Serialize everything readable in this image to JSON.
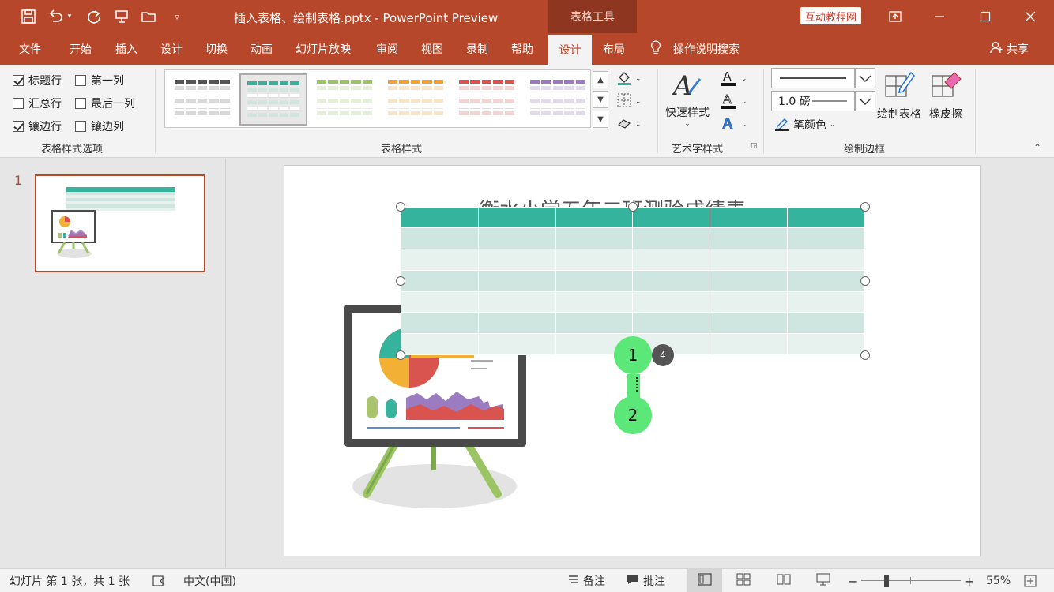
{
  "title_bar": {
    "doc_title": "插入表格、绘制表格.pptx  -  PowerPoint Preview",
    "context_tool": "表格工具",
    "promo_label": "互动教程网",
    "quick_access": [
      "save-icon",
      "undo-icon",
      "redo-icon",
      "present-icon",
      "open-icon",
      "customize-icon"
    ]
  },
  "tabs": [
    "文件",
    "开始",
    "插入",
    "设计",
    "切换",
    "动画",
    "幻灯片放映",
    "审阅",
    "视图",
    "录制",
    "帮助",
    "设计",
    "布局"
  ],
  "active_tab_index": 11,
  "tell_me": "操作说明搜索",
  "share": "共享",
  "ribbon": {
    "style_options": {
      "items": [
        {
          "label": "标题行",
          "checked": true
        },
        {
          "label": "第一列",
          "checked": false
        },
        {
          "label": "汇总行",
          "checked": false
        },
        {
          "label": "最后一列",
          "checked": false
        },
        {
          "label": "镶边行",
          "checked": true
        },
        {
          "label": "镶边列",
          "checked": false
        }
      ],
      "group_label": "表格样式选项"
    },
    "table_styles": {
      "group_label": "表格样式",
      "swatches": [
        {
          "header": "#555555",
          "band": "#d9d9d9"
        },
        {
          "header": "#36b39c",
          "band": "#cfe5df"
        },
        {
          "header": "#9bc465",
          "band": "#e3efd6"
        },
        {
          "header": "#f2a23c",
          "band": "#fbe3c6"
        },
        {
          "header": "#d9534f",
          "band": "#f5d3d1"
        },
        {
          "header": "#9b7cc1",
          "band": "#e2daee"
        }
      ],
      "selected_index": 1
    },
    "word_art": {
      "quick_styles": "快速样式",
      "group_label": "艺术字样式"
    },
    "draw_borders": {
      "pen_weight": "1.0 磅",
      "pen_color": "笔颜色",
      "draw_table": "绘制表格",
      "eraser": "橡皮擦",
      "group_label": "绘制边框"
    }
  },
  "slides_pane": {
    "slide_number": "1"
  },
  "slide": {
    "title": "衡水小学五年二班测验成绩表",
    "table": {
      "columns": 6,
      "rows": 7,
      "header_color": "#36b39c",
      "band_odd": "#cfe5df",
      "band_even": "#e7f2ef"
    },
    "steps": [
      "1",
      "2"
    ],
    "step_badge": "4"
  },
  "status_bar": {
    "slide_info": "幻灯片 第 1 张，共 1 张",
    "language": "中文(中国)",
    "notes": "备注",
    "comments": "批注",
    "zoom": "55%",
    "zoom_level": 0.55
  },
  "colors": {
    "accent": "#b7472a",
    "table_teal": "#36b39c",
    "step_green": "#5ce879"
  }
}
